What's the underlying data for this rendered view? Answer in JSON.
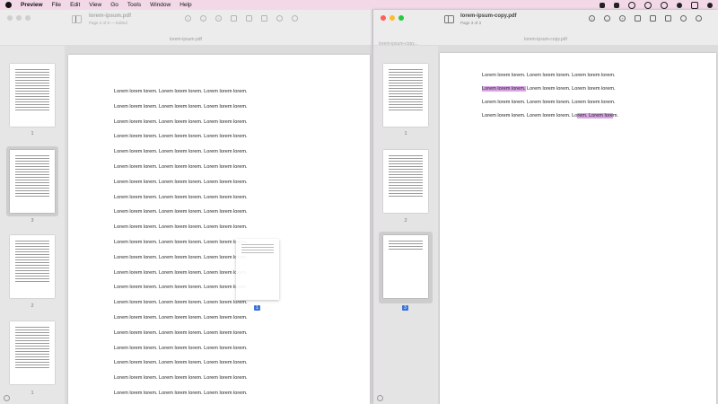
{
  "menubar": {
    "app_name": "Preview",
    "items": [
      "File",
      "Edit",
      "View",
      "Go",
      "Tools",
      "Window",
      "Help"
    ]
  },
  "left_window": {
    "title": "lorem-ipsum.pdf",
    "subtitle": "Page 2 of 8 — Edited",
    "tab_label": "lorem-ipsum.pdf",
    "sidebar_pages": [
      "1",
      "3",
      "2",
      "1"
    ],
    "lines": [
      "Lorem lorem lorem. Lorem lorem lorem. Lorem lorem lorem.",
      "Lorem lorem lorem. Lorem lorem lorem. Lorem lorem lorem.",
      "Lorem lorem lorem. Lorem lorem lorem. Lorem lorem lorem.",
      "Lorem lorem lorem. Lorem lorem lorem. Lorem lorem lorem.",
      "Lorem lorem lorem. Lorem lorem lorem. Lorem lorem lorem.",
      "Lorem lorem lorem. Lorem lorem lorem. Lorem lorem lorem.",
      "Lorem lorem lorem. Lorem lorem lorem. Lorem lorem lorem.",
      "Lorem lorem lorem. Lorem lorem lorem. Lorem lorem lorem.",
      "Lorem lorem lorem. Lorem lorem lorem. Lorem lorem lorem.",
      "Lorem lorem lorem. Lorem lorem lorem. Lorem lorem lorem.",
      "Lorem lorem lorem. Lorem lorem lorem. Lorem lorem lorem.",
      "Lorem lorem lorem. Lorem lorem lorem. Lorem lorem lorem.",
      "Lorem lorem lorem. Lorem lorem lorem. Lorem lorem lorem.",
      "Lorem lorem lorem. Lorem lorem lorem. Lorem lorem lorem.",
      "Lorem lorem lorem. Lorem lorem lorem. Lorem lorem lorem.",
      "Lorem lorem lorem. Lorem lorem lorem. Lorem lorem lorem.",
      "Lorem lorem lorem. Lorem lorem lorem. Lorem lorem lorem.",
      "Lorem lorem lorem. Lorem lorem lorem. Lorem lorem lorem.",
      "Lorem lorem lorem. Lorem lorem lorem. Lorem lorem lorem.",
      "Lorem lorem lorem. Lorem lorem lorem. Lorem lorem lorem.",
      "Lorem lorem lorem. Lorem lorem lorem. Lorem lorem lorem.",
      "Lorem lorem lorem. Lorem lorem lorem. Lorem lorem lorem."
    ],
    "drag_badge": "1"
  },
  "right_window": {
    "title": "lorem-ipsum-copy.pdf",
    "subtitle": "Page 3 of 3",
    "tab_label": "lorem-ipsum-copy.pdf",
    "sidebar_title": "lorem-ipsum-copy...",
    "sidebar_pages": [
      "1",
      "2",
      "3"
    ],
    "line_1": "Lorem lorem lorem. Lorem lorem lorem. Lorem lorem lorem.",
    "line_2_highlight": "Lorem lorem lorem.",
    "line_2_rest": " Lorem lorem lorem. Lorem lorem lorem.",
    "line_3": "Lorem lorem lorem. Lorem lorem lorem. Lorem lorem lorem.",
    "line_4_start": "Lorem lorem lorem. Lorem lorem lorem. Lo",
    "line_4_highlight": "rem. Lorem lore",
    "line_4_end": "m.",
    "highlight_color": "#d9a6e6"
  },
  "colors": {
    "menubar_bg": "#f3d9e8",
    "selection_blue": "#3a74d8"
  }
}
